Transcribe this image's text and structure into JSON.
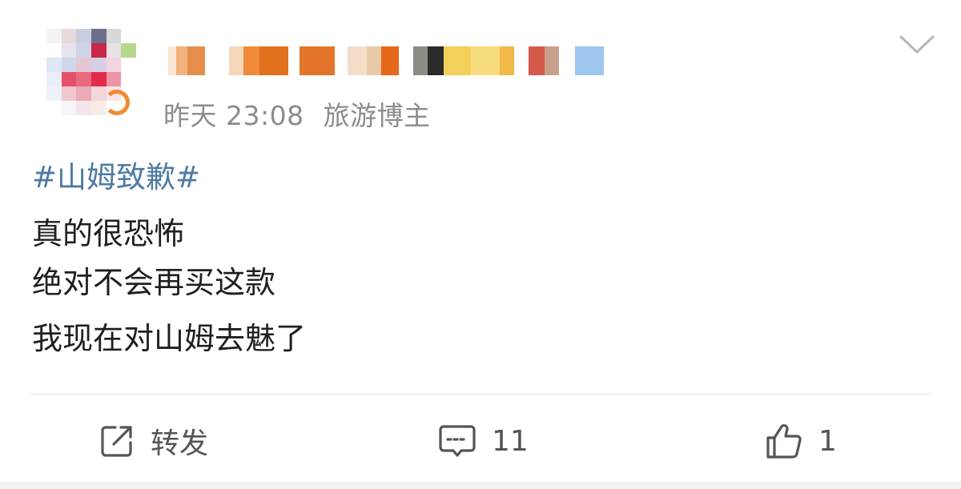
{
  "post": {
    "timestamp": "昨天 23:08",
    "source": "旅游博主",
    "hashtag": "#山姆致歉#",
    "lines": [
      "真的很恐怖",
      "绝对不会再买这款",
      "我现在对山姆去魅了"
    ]
  },
  "actions": {
    "repost_label": "转发",
    "comment_count": "11",
    "like_count": "1"
  },
  "icons": {
    "more": "chevron-down-icon",
    "repost": "share-icon",
    "comment": "comment-icon",
    "like": "thumbs-up-icon"
  },
  "colors": {
    "hashtag": "#4e7aa3",
    "meta_text": "#8c8c8c",
    "body_text": "#1f1f1f",
    "action_text": "#555555",
    "divider": "#e6e6e6"
  }
}
